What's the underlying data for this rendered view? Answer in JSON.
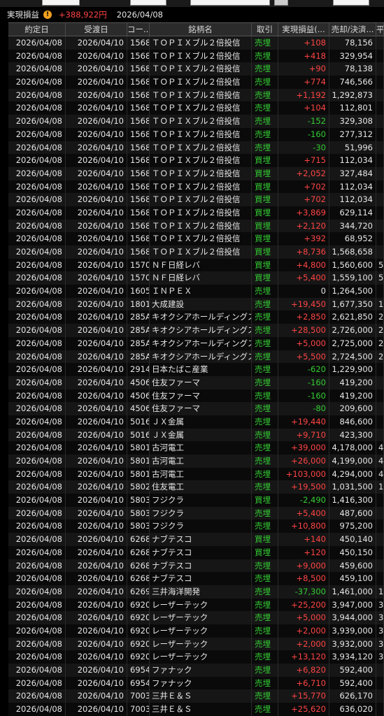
{
  "summary": {
    "label": "実現損益",
    "icon": "warning-icon",
    "total_pnl": "+388,922円",
    "date": "2026/04/08"
  },
  "columns": [
    "約定日",
    "受渡日",
    "コー...",
    "銘柄名",
    "取引",
    "実現損益(...",
    "売却/決済...",
    "平"
  ],
  "rows": [
    [
      "2026/04/08",
      "2026/04/10",
      "1568",
      "ＴＯＰＩＸブル２倍投信",
      "売埋",
      "+108",
      "78,156",
      ""
    ],
    [
      "2026/04/08",
      "2026/04/10",
      "1568",
      "ＴＯＰＩＸブル２倍投信",
      "売埋",
      "+418",
      "329,954",
      ""
    ],
    [
      "2026/04/08",
      "2026/04/10",
      "1568",
      "ＴＯＰＩＸブル２倍投信",
      "売埋",
      "+90",
      "78,138",
      ""
    ],
    [
      "2026/04/08",
      "2026/04/10",
      "1568",
      "ＴＯＰＩＸブル２倍投信",
      "売埋",
      "+774",
      "746,566",
      ""
    ],
    [
      "2026/04/08",
      "2026/04/10",
      "1568",
      "ＴＯＰＩＸブル２倍投信",
      "売埋",
      "+1,192",
      "1,292,873",
      ""
    ],
    [
      "2026/04/08",
      "2026/04/10",
      "1568",
      "ＴＯＰＩＸブル２倍投信",
      "売埋",
      "+104",
      "112,801",
      ""
    ],
    [
      "2026/04/08",
      "2026/04/10",
      "1568",
      "ＴＯＰＩＸブル２倍投信",
      "売埋",
      "-152",
      "329,308",
      ""
    ],
    [
      "2026/04/08",
      "2026/04/10",
      "1568",
      "ＴＯＰＩＸブル２倍投信",
      "売埋",
      "-160",
      "277,312",
      ""
    ],
    [
      "2026/04/08",
      "2026/04/10",
      "1568",
      "ＴＯＰＩＸブル２倍投信",
      "売埋",
      "-30",
      "51,996",
      ""
    ],
    [
      "2026/04/08",
      "2026/04/10",
      "1568",
      "ＴＯＰＩＸブル２倍投信",
      "買埋",
      "+715",
      "112,034",
      ""
    ],
    [
      "2026/04/08",
      "2026/04/10",
      "1568",
      "ＴＯＰＩＸブル２倍投信",
      "買埋",
      "+2,052",
      "327,484",
      ""
    ],
    [
      "2026/04/08",
      "2026/04/10",
      "1568",
      "ＴＯＰＩＸブル２倍投信",
      "買埋",
      "+702",
      "112,034",
      ""
    ],
    [
      "2026/04/08",
      "2026/04/10",
      "1568",
      "ＴＯＰＩＸブル２倍投信",
      "買埋",
      "+702",
      "112,034",
      ""
    ],
    [
      "2026/04/08",
      "2026/04/10",
      "1568",
      "ＴＯＰＩＸブル２倍投信",
      "買埋",
      "+3,869",
      "629,114",
      ""
    ],
    [
      "2026/04/08",
      "2026/04/10",
      "1568",
      "ＴＯＰＩＸブル２倍投信",
      "買埋",
      "+2,120",
      "344,720",
      ""
    ],
    [
      "2026/04/08",
      "2026/04/10",
      "1568",
      "ＴＯＰＩＸブル２倍投信",
      "買埋",
      "+392",
      "68,952",
      ""
    ],
    [
      "2026/04/08",
      "2026/04/10",
      "1568",
      "ＴＯＰＩＸブル２倍投信",
      "買埋",
      "+8,736",
      "1,568,658",
      ""
    ],
    [
      "2026/04/08",
      "2026/04/10",
      "1570",
      "ＮＦ日経レバ",
      "買埋",
      "+4,800",
      "1,560,600",
      "5"
    ],
    [
      "2026/04/08",
      "2026/04/10",
      "1570",
      "ＮＦ日経レバ",
      "買埋",
      "+5,400",
      "1,559,100",
      "5"
    ],
    [
      "2026/04/08",
      "2026/04/10",
      "1605",
      "ＩＮＰＥＸ",
      "売埋",
      "0",
      "1,264,500",
      ""
    ],
    [
      "2026/04/08",
      "2026/04/10",
      "1801",
      "大成建設",
      "売埋",
      "+19,450",
      "1,677,350",
      "1"
    ],
    [
      "2026/04/08",
      "2026/04/10",
      "285A",
      "キオクシアホールディングス",
      "売埋",
      "+2,850",
      "2,621,850",
      "2"
    ],
    [
      "2026/04/08",
      "2026/04/10",
      "285A",
      "キオクシアホールディングス",
      "売埋",
      "+28,500",
      "2,726,000",
      "2"
    ],
    [
      "2026/04/08",
      "2026/04/10",
      "285A",
      "キオクシアホールディングス",
      "売埋",
      "+5,000",
      "2,725,000",
      "2"
    ],
    [
      "2026/04/08",
      "2026/04/10",
      "285A",
      "キオクシアホールディングス",
      "売埋",
      "+5,500",
      "2,724,500",
      "2"
    ],
    [
      "2026/04/08",
      "2026/04/10",
      "2914",
      "日本たばこ産業",
      "売埋",
      "-620",
      "1,229,900",
      ""
    ],
    [
      "2026/04/08",
      "2026/04/10",
      "4506",
      "住友ファーマ",
      "売埋",
      "-160",
      "419,200",
      ""
    ],
    [
      "2026/04/08",
      "2026/04/10",
      "4506",
      "住友ファーマ",
      "売埋",
      "-160",
      "419,200",
      ""
    ],
    [
      "2026/04/08",
      "2026/04/10",
      "4506",
      "住友ファーマ",
      "売埋",
      "-80",
      "209,600",
      ""
    ],
    [
      "2026/04/08",
      "2026/04/10",
      "5016",
      "ＪＸ金属",
      "売埋",
      "+19,440",
      "846,600",
      ""
    ],
    [
      "2026/04/08",
      "2026/04/10",
      "5016",
      "ＪＸ金属",
      "売埋",
      "+9,710",
      "423,300",
      ""
    ],
    [
      "2026/04/08",
      "2026/04/10",
      "5801",
      "古河電工",
      "売埋",
      "+39,000",
      "4,178,000",
      "4"
    ],
    [
      "2026/04/08",
      "2026/04/10",
      "5801",
      "古河電工",
      "売埋",
      "+26,000",
      "4,199,000",
      "4"
    ],
    [
      "2026/04/08",
      "2026/04/10",
      "5801",
      "古河電工",
      "売埋",
      "+103,000",
      "4,294,000",
      "4"
    ],
    [
      "2026/04/08",
      "2026/04/10",
      "5802",
      "住友電工",
      "売埋",
      "+19,500",
      "1,031,500",
      "1"
    ],
    [
      "2026/04/08",
      "2026/04/10",
      "5803",
      "フジクラ",
      "買埋",
      "-2,490",
      "1,416,300",
      ""
    ],
    [
      "2026/04/08",
      "2026/04/10",
      "5803",
      "フジクラ",
      "売埋",
      "+5,400",
      "487,600",
      ""
    ],
    [
      "2026/04/08",
      "2026/04/10",
      "5803",
      "フジクラ",
      "売埋",
      "+10,800",
      "975,200",
      ""
    ],
    [
      "2026/04/08",
      "2026/04/10",
      "6268",
      "ナブテスコ",
      "買埋",
      "+140",
      "450,140",
      ""
    ],
    [
      "2026/04/08",
      "2026/04/10",
      "6268",
      "ナブテスコ",
      "買埋",
      "+120",
      "450,150",
      ""
    ],
    [
      "2026/04/08",
      "2026/04/10",
      "6268",
      "ナブテスコ",
      "売埋",
      "+9,000",
      "459,600",
      ""
    ],
    [
      "2026/04/08",
      "2026/04/10",
      "6268",
      "ナブテスコ",
      "売埋",
      "+8,500",
      "459,100",
      ""
    ],
    [
      "2026/04/08",
      "2026/04/10",
      "6269",
      "三井海洋開発",
      "売埋",
      "-37,300",
      "1,461,000",
      "1"
    ],
    [
      "2026/04/08",
      "2026/04/10",
      "6920",
      "レーザーテック",
      "売埋",
      "+25,200",
      "3,947,000",
      "3"
    ],
    [
      "2026/04/08",
      "2026/04/10",
      "6920",
      "レーザーテック",
      "売埋",
      "+5,000",
      "3,944,000",
      "3"
    ],
    [
      "2026/04/08",
      "2026/04/10",
      "6920",
      "レーザーテック",
      "売埋",
      "+2,000",
      "3,939,000",
      "3"
    ],
    [
      "2026/04/08",
      "2026/04/10",
      "6920",
      "レーザーテック",
      "売埋",
      "+2,000",
      "3,932,000",
      "3"
    ],
    [
      "2026/04/08",
      "2026/04/10",
      "6920",
      "レーザーテック",
      "売埋",
      "+13,120",
      "3,934,120",
      "3"
    ],
    [
      "2026/04/08",
      "2026/04/10",
      "6954",
      "ファナック",
      "売埋",
      "+6,820",
      "592,400",
      ""
    ],
    [
      "2026/04/08",
      "2026/04/10",
      "6954",
      "ファナック",
      "売埋",
      "+6,710",
      "592,400",
      ""
    ],
    [
      "2026/04/08",
      "2026/04/10",
      "7003",
      "三井Ｅ＆Ｓ",
      "売埋",
      "+15,770",
      "626,170",
      ""
    ],
    [
      "2026/04/08",
      "2026/04/10",
      "7003",
      "三井Ｅ＆Ｓ",
      "売埋",
      "+25,620",
      "636,020",
      ""
    ]
  ],
  "colors": {
    "positive": "#ff4444",
    "negative": "#33cc33",
    "trade_type": "#33cc33",
    "background": "#000000"
  }
}
